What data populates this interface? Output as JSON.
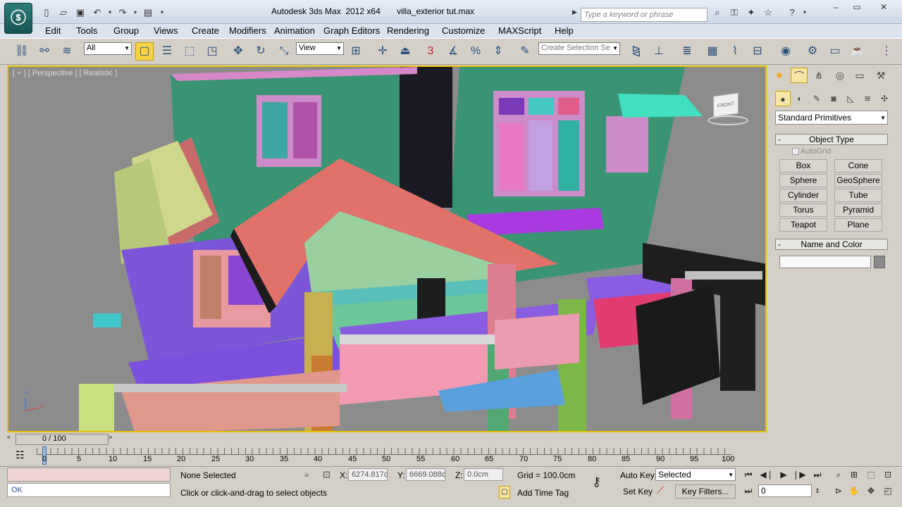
{
  "titlebar": {
    "logo": "3ds-max-logo",
    "title": "Autodesk 3ds Max  2012 x64       villa_exterior tut.max",
    "search_placeholder": "Type a keyword or phrase",
    "window_min": "–",
    "window_restore": "▭",
    "window_close": "✕"
  },
  "menu": [
    "Edit",
    "Tools",
    "Group",
    "Views",
    "Create",
    "Modifiers",
    "Animation",
    "Graph Editors",
    "Rendering",
    "Customize",
    "MAXScript",
    "Help"
  ],
  "toolbar": {
    "filter_value": "All",
    "refcoord_value": "View",
    "selection_set_placeholder": "Create Selection Se",
    "snap_label": "3",
    "accent": "#f0c000"
  },
  "viewport": {
    "label": "[ + ] [ Perspective ] [ Realistic ]",
    "viewcube_face": "FRONT",
    "axis_z": "z",
    "axis_x": "x"
  },
  "command_panel": {
    "primitive_type": "Standard Primitives",
    "object_type_title": "Object Type",
    "autogrid_label": "AutoGrid",
    "buttons": [
      "Box",
      "Cone",
      "Sphere",
      "GeoSphere",
      "Cylinder",
      "Tube",
      "Torus",
      "Pyramid",
      "Teapot",
      "Plane"
    ],
    "name_color_title": "Name and Color"
  },
  "timeline": {
    "slider_label": "0 / 100",
    "ticks": [
      "0",
      "5",
      "10",
      "15",
      "20",
      "25",
      "30",
      "35",
      "40",
      "45",
      "50",
      "55",
      "60",
      "65",
      "70",
      "75",
      "80",
      "85",
      "90",
      "95",
      "100"
    ]
  },
  "status": {
    "selection": "None Selected",
    "prompt": "Click or click-and-drag to select objects",
    "maxscript_listener": "OK",
    "x_label": "X:",
    "x_value": "6274.817c",
    "y_label": "Y:",
    "y_value": "6669.088c",
    "z_label": "Z:",
    "z_value": "0.0cm",
    "grid": "Grid = 100.0cm",
    "add_time_tag": "Add Time Tag",
    "auto_key": "Auto Key",
    "set_key": "Set Key",
    "key_mode": "Selected",
    "key_filters": "Key Filters...",
    "current_frame": "0"
  }
}
